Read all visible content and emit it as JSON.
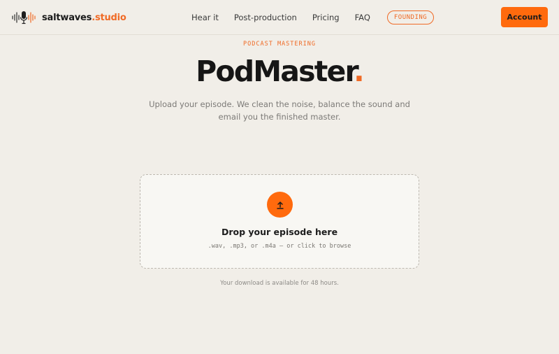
{
  "header": {
    "brand_name": "saltwaves",
    "brand_suffix": ".studio",
    "nav": [
      "Hear it",
      "Post-production",
      "Pricing",
      "FAQ"
    ],
    "badge": "FOUNDING",
    "account_label": "Account"
  },
  "hero": {
    "eyebrow": "PODCAST MASTERING",
    "title": "PodMaster",
    "title_dot": ".",
    "subtitle": "Upload your episode. We clean the noise, balance the sound and email you the finished master."
  },
  "dropzone": {
    "title": "Drop your episode here",
    "hint": ".wav, .mp3, or .m4a — or click to browse"
  },
  "footnote": "Your download is available for 48 hours.",
  "colors": {
    "accent": "#ff6a0d",
    "accent_text": "#f06a25",
    "background": "#f1eee8"
  },
  "icons": {
    "logo": "waveform-microphone-logo",
    "upload": "upload-arrow-icon"
  }
}
